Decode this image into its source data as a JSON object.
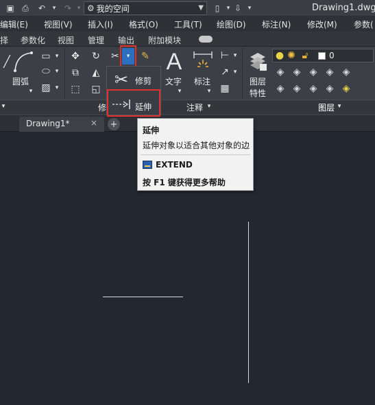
{
  "titlebar": {
    "workspace": "我的空间",
    "document_title": "Drawing1.dwg"
  },
  "menubar": {
    "items": [
      "编辑(E)",
      "视图(V)",
      "插入(I)",
      "格式(O)",
      "工具(T)",
      "绘图(D)",
      "标注(N)",
      "修改(M)",
      "参数("
    ]
  },
  "ribbon_tabs": [
    "择",
    "参数化",
    "视图",
    "管理",
    "输出",
    "附加模块"
  ],
  "ribbon": {
    "draw": {
      "arc_label": "圆弧"
    },
    "modify": {
      "panel_title": "修",
      "trim_label": "修剪",
      "extend_label": "延伸"
    },
    "annotation": {
      "text_label": "文字",
      "dimension_label": "标注",
      "panel_title": "注释"
    },
    "layers": {
      "layer_props_label_1": "图层",
      "layer_props_label_2": "特性",
      "current_layer": "0",
      "panel_title": "图层"
    }
  },
  "doc_tabs": {
    "active": "Drawing1*",
    "close": "×",
    "new": "+"
  },
  "tooltip": {
    "title": "延伸",
    "description": "延伸对象以适合其他对象的边",
    "command": "EXTEND",
    "help": "按 F1 键获得更多帮助"
  },
  "colors": {
    "canvas": "#212830",
    "highlight": "#e0312f",
    "ribbon": "#3c4046"
  }
}
